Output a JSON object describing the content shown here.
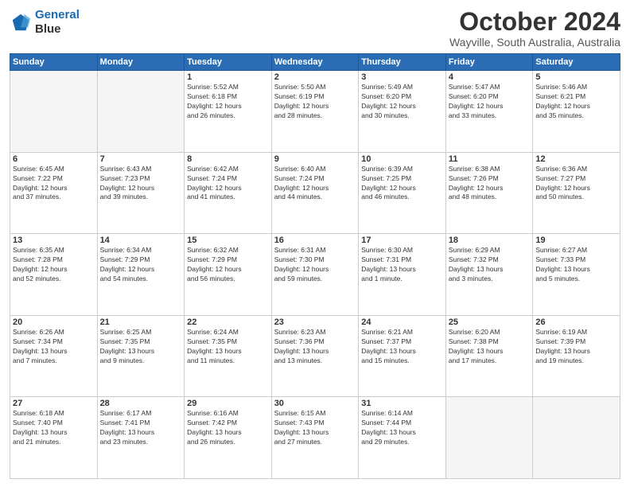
{
  "header": {
    "logo_line1": "General",
    "logo_line2": "Blue",
    "title": "October 2024",
    "subtitle": "Wayville, South Australia, Australia"
  },
  "weekdays": [
    "Sunday",
    "Monday",
    "Tuesday",
    "Wednesday",
    "Thursday",
    "Friday",
    "Saturday"
  ],
  "weeks": [
    [
      {
        "day": "",
        "info": ""
      },
      {
        "day": "",
        "info": ""
      },
      {
        "day": "1",
        "info": "Sunrise: 5:52 AM\nSunset: 6:18 PM\nDaylight: 12 hours\nand 26 minutes."
      },
      {
        "day": "2",
        "info": "Sunrise: 5:50 AM\nSunset: 6:19 PM\nDaylight: 12 hours\nand 28 minutes."
      },
      {
        "day": "3",
        "info": "Sunrise: 5:49 AM\nSunset: 6:20 PM\nDaylight: 12 hours\nand 30 minutes."
      },
      {
        "day": "4",
        "info": "Sunrise: 5:47 AM\nSunset: 6:20 PM\nDaylight: 12 hours\nand 33 minutes."
      },
      {
        "day": "5",
        "info": "Sunrise: 5:46 AM\nSunset: 6:21 PM\nDaylight: 12 hours\nand 35 minutes."
      }
    ],
    [
      {
        "day": "6",
        "info": "Sunrise: 6:45 AM\nSunset: 7:22 PM\nDaylight: 12 hours\nand 37 minutes."
      },
      {
        "day": "7",
        "info": "Sunrise: 6:43 AM\nSunset: 7:23 PM\nDaylight: 12 hours\nand 39 minutes."
      },
      {
        "day": "8",
        "info": "Sunrise: 6:42 AM\nSunset: 7:24 PM\nDaylight: 12 hours\nand 41 minutes."
      },
      {
        "day": "9",
        "info": "Sunrise: 6:40 AM\nSunset: 7:24 PM\nDaylight: 12 hours\nand 44 minutes."
      },
      {
        "day": "10",
        "info": "Sunrise: 6:39 AM\nSunset: 7:25 PM\nDaylight: 12 hours\nand 46 minutes."
      },
      {
        "day": "11",
        "info": "Sunrise: 6:38 AM\nSunset: 7:26 PM\nDaylight: 12 hours\nand 48 minutes."
      },
      {
        "day": "12",
        "info": "Sunrise: 6:36 AM\nSunset: 7:27 PM\nDaylight: 12 hours\nand 50 minutes."
      }
    ],
    [
      {
        "day": "13",
        "info": "Sunrise: 6:35 AM\nSunset: 7:28 PM\nDaylight: 12 hours\nand 52 minutes."
      },
      {
        "day": "14",
        "info": "Sunrise: 6:34 AM\nSunset: 7:29 PM\nDaylight: 12 hours\nand 54 minutes."
      },
      {
        "day": "15",
        "info": "Sunrise: 6:32 AM\nSunset: 7:29 PM\nDaylight: 12 hours\nand 56 minutes."
      },
      {
        "day": "16",
        "info": "Sunrise: 6:31 AM\nSunset: 7:30 PM\nDaylight: 12 hours\nand 59 minutes."
      },
      {
        "day": "17",
        "info": "Sunrise: 6:30 AM\nSunset: 7:31 PM\nDaylight: 13 hours\nand 1 minute."
      },
      {
        "day": "18",
        "info": "Sunrise: 6:29 AM\nSunset: 7:32 PM\nDaylight: 13 hours\nand 3 minutes."
      },
      {
        "day": "19",
        "info": "Sunrise: 6:27 AM\nSunset: 7:33 PM\nDaylight: 13 hours\nand 5 minutes."
      }
    ],
    [
      {
        "day": "20",
        "info": "Sunrise: 6:26 AM\nSunset: 7:34 PM\nDaylight: 13 hours\nand 7 minutes."
      },
      {
        "day": "21",
        "info": "Sunrise: 6:25 AM\nSunset: 7:35 PM\nDaylight: 13 hours\nand 9 minutes."
      },
      {
        "day": "22",
        "info": "Sunrise: 6:24 AM\nSunset: 7:35 PM\nDaylight: 13 hours\nand 11 minutes."
      },
      {
        "day": "23",
        "info": "Sunrise: 6:23 AM\nSunset: 7:36 PM\nDaylight: 13 hours\nand 13 minutes."
      },
      {
        "day": "24",
        "info": "Sunrise: 6:21 AM\nSunset: 7:37 PM\nDaylight: 13 hours\nand 15 minutes."
      },
      {
        "day": "25",
        "info": "Sunrise: 6:20 AM\nSunset: 7:38 PM\nDaylight: 13 hours\nand 17 minutes."
      },
      {
        "day": "26",
        "info": "Sunrise: 6:19 AM\nSunset: 7:39 PM\nDaylight: 13 hours\nand 19 minutes."
      }
    ],
    [
      {
        "day": "27",
        "info": "Sunrise: 6:18 AM\nSunset: 7:40 PM\nDaylight: 13 hours\nand 21 minutes."
      },
      {
        "day": "28",
        "info": "Sunrise: 6:17 AM\nSunset: 7:41 PM\nDaylight: 13 hours\nand 23 minutes."
      },
      {
        "day": "29",
        "info": "Sunrise: 6:16 AM\nSunset: 7:42 PM\nDaylight: 13 hours\nand 26 minutes."
      },
      {
        "day": "30",
        "info": "Sunrise: 6:15 AM\nSunset: 7:43 PM\nDaylight: 13 hours\nand 27 minutes."
      },
      {
        "day": "31",
        "info": "Sunrise: 6:14 AM\nSunset: 7:44 PM\nDaylight: 13 hours\nand 29 minutes."
      },
      {
        "day": "",
        "info": ""
      },
      {
        "day": "",
        "info": ""
      }
    ]
  ]
}
